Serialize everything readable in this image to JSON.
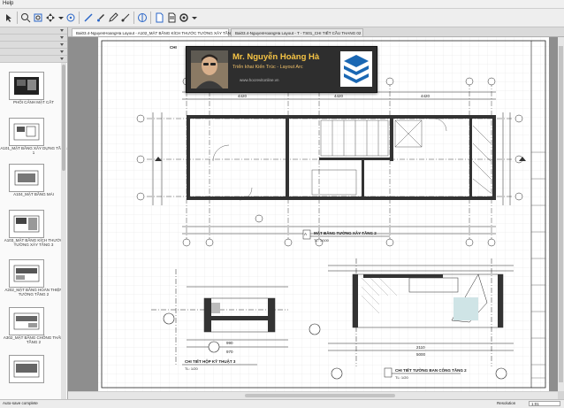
{
  "menu": {
    "help": "Help"
  },
  "tabs": [
    {
      "label": "Bai03.4-NguyenHoangHa Layout - A102_MẶT BẰNG KÍCH THƯỚC TƯỜNG XÂY TẦNG 2",
      "active": true
    },
    {
      "label": "Bai03.4-NguyenHoangHa Layout - T - TS01_CHI TIẾT CẦU THANG 02",
      "active": false
    }
  ],
  "thumbnails": [
    {
      "label": "PHỐI CẢNH MẶT CẮT"
    },
    {
      "label": "A101_MẶT BẰNG XÂY DỰNG TẦNG 1"
    },
    {
      "label": "A104_MẶT BẰNG MÁI"
    },
    {
      "label": "A103_MẶT BẰNG KÍCH THƯỚC TƯỜNG XÂY TẦNG 3"
    },
    {
      "label": "A202_MẶT BẰNG HOÀN THIỆN TƯỜNG TẦNG 2"
    },
    {
      "label": "A302_MẶT BẰNG CHỐNG THẤM TẦNG 2"
    },
    {
      "label": ""
    }
  ],
  "banner": {
    "name": "Mr. Nguyễn Hoàng Hà",
    "subtitle": "Triển khai Kiến Trúc - Layout Arc",
    "website": "www.hocrevitonline.vn"
  },
  "drawing": {
    "plan_title": "MẶT BẰNG TƯỜNG XÂY TẦNG 2",
    "plan_scale": "TL: 1/100",
    "plan_number": "A",
    "detail1_title": "CHI TIẾT HỘP KỸ THUẬT 3",
    "detail1_scale": "TL: 1/20",
    "detail2_title": "CHI TIẾT TƯỜNG BAN CÔNG TẦNG 2",
    "detail2_scale": "TL: 1/20",
    "tag_1": "CHI",
    "dim_4420": "4420",
    "dim_2110": "2110",
    "dim_5000": "5000",
    "dim_970": "970",
    "dim_990": "990"
  },
  "status": {
    "left": "Auto-save complete",
    "zoom_label": "Resolution",
    "zoom": "1:01"
  }
}
